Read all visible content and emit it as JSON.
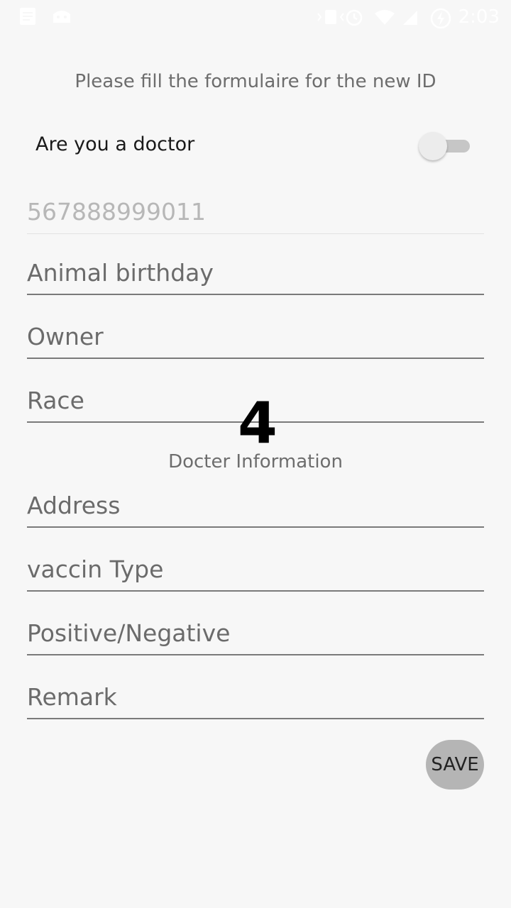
{
  "status_bar": {
    "time": "2:03",
    "left_icons": [
      "notes-icon",
      "android-debug-icon"
    ],
    "right_icons": [
      "vibrate-icon",
      "alarm-icon",
      "wifi-icon",
      "signal-icon",
      "battery-charging-icon"
    ]
  },
  "form": {
    "title": "Please fill the formulaire for the new ID",
    "doctor_toggle": {
      "label": "Are you a doctor",
      "checked": false
    },
    "id_field": {
      "value": "567888999011",
      "enabled": false
    },
    "fields": {
      "animal_birthday": {
        "placeholder": "Animal birthday"
      },
      "owner": {
        "placeholder": "Owner"
      },
      "race": {
        "placeholder": "Race"
      }
    },
    "overlay_number": "4",
    "doctor_section": {
      "title": "Docter Information",
      "address": {
        "placeholder": "Address"
      },
      "vaccin_type": {
        "placeholder": "vaccin Type"
      },
      "positive_negative": {
        "placeholder": "Positive/Negative"
      },
      "remark": {
        "placeholder": "Remark"
      }
    },
    "save_label": "SAVE"
  },
  "colors": {
    "background": "#f7f7f7",
    "text_secondary": "#6d6d6d",
    "button_bg": "#b5b5b5"
  }
}
